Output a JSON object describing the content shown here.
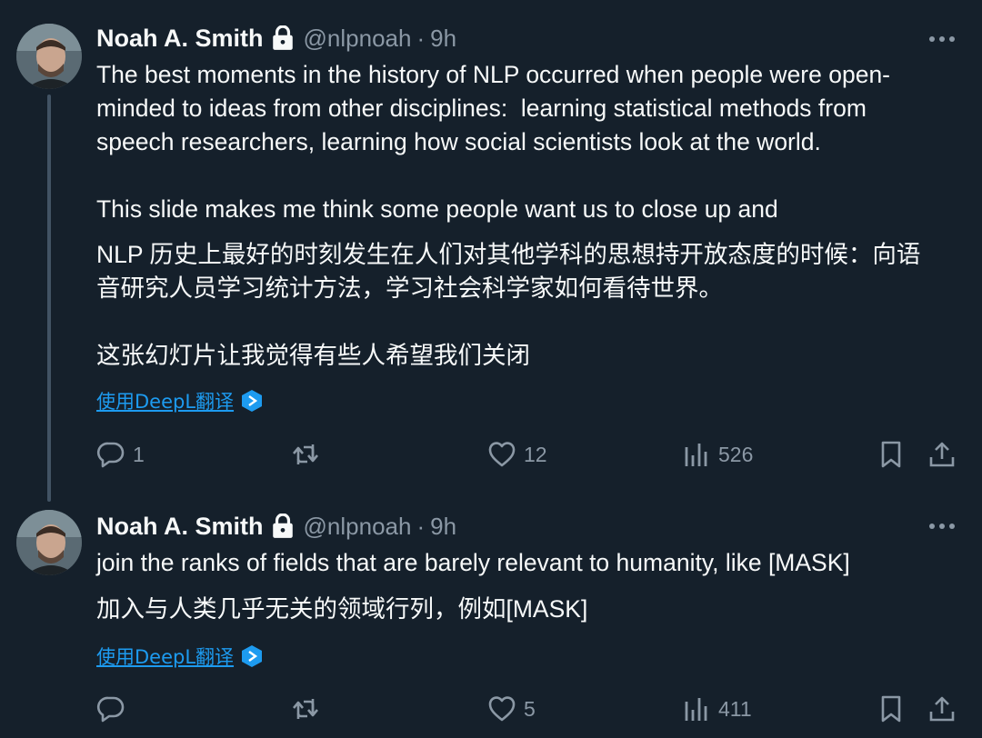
{
  "tweets": [
    {
      "author_name": "Noah A. Smith",
      "handle": "@nlpnoah",
      "separator": "·",
      "time": "9h",
      "text_en": "The best moments in the history of NLP occurred when people were open-\nminded to ideas from other disciplines:  learning statistical methods from\nspeech researchers, learning how social scientists look at the world.\n\nThis slide makes me think some people want us to close up and",
      "text_zh": "NLP 历史上最好的时刻发生在人们对其他学科的思想持开放态度的时候：向语\n音研究人员学习统计方法，学习社会科学家如何看待世界。\n\n这张幻灯片让我觉得有些人希望我们关闭",
      "translate_label": "使用DeepL翻译",
      "reply_count": "1",
      "retweet_count": "",
      "like_count": "12",
      "view_count": "526"
    },
    {
      "author_name": "Noah A. Smith",
      "handle": "@nlpnoah",
      "separator": "·",
      "time": "9h",
      "text_en": "join the ranks of fields that are barely relevant to humanity, like [MASK]",
      "text_zh": "加入与人类几乎无关的领域行列，例如[MASK]",
      "translate_label": "使用DeepL翻译",
      "reply_count": "",
      "retweet_count": "",
      "like_count": "5",
      "view_count": "411"
    }
  ],
  "icons": [
    "lock-icon",
    "more-icon",
    "deepl-icon",
    "reply-icon",
    "retweet-icon",
    "like-icon",
    "views-icon",
    "bookmark-icon",
    "share-icon"
  ],
  "colors": {
    "background": "#15202b",
    "text_primary": "#f7f9f9",
    "text_secondary": "#8b98a5",
    "link": "#1d9bf0",
    "thread_line": "#425364"
  }
}
